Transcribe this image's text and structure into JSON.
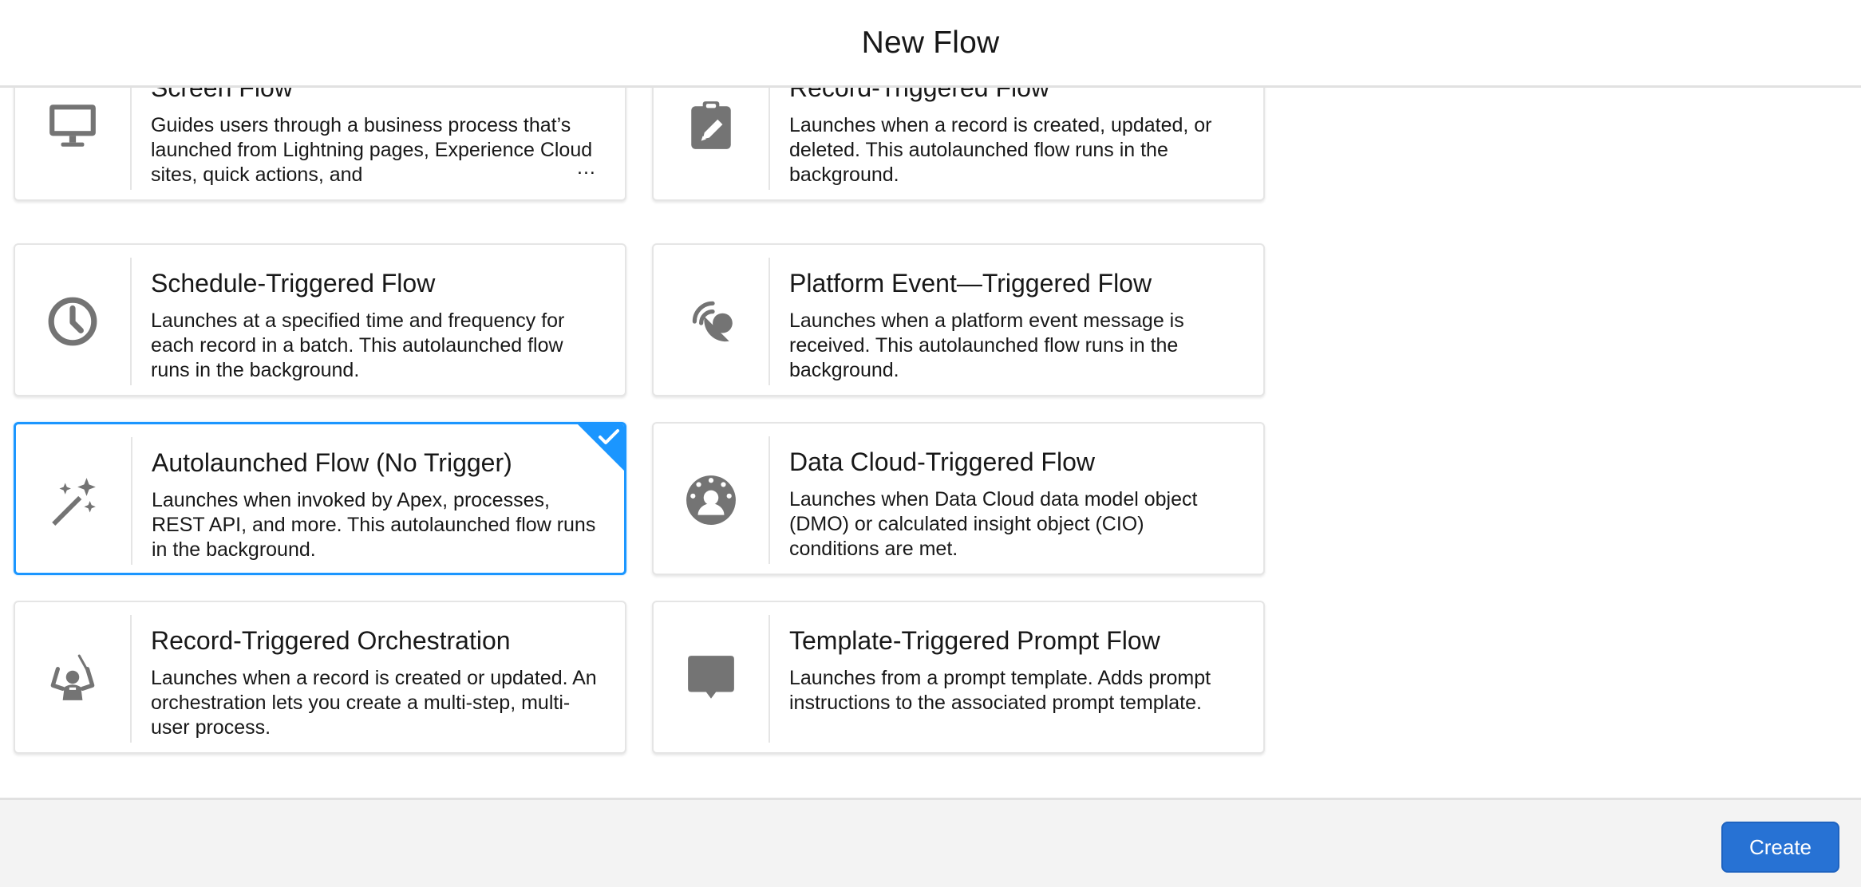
{
  "header": {
    "title": "New Flow"
  },
  "flow_types": [
    {
      "title": "Screen Flow",
      "description": "Guides users through a business process that’s launched from Lightning pages, Experience Cloud sites, quick actions, and",
      "more": "...",
      "icon": "monitor-icon",
      "selected": false
    },
    {
      "title": "Record-Triggered Flow",
      "description": "Launches when a record is created, updated, or deleted. This autolaunched flow runs in the background.",
      "icon": "clipboard-edit-icon",
      "selected": false
    },
    {
      "title": "Schedule-Triggered Flow",
      "description": "Launches at a specified time and frequency for each record in a batch. This autolaunched flow runs in the background.",
      "icon": "clock-icon",
      "selected": false
    },
    {
      "title": "Platform Event—Triggered Flow",
      "description": "Launches when a platform event message is received. This autolaunched flow runs in the background.",
      "icon": "satellite-dish-icon",
      "selected": false
    },
    {
      "title": "Autolaunched Flow (No Trigger)",
      "description": "Launches when invoked by Apex, processes, REST API, and more. This autolaunched flow runs in the background.",
      "icon": "magic-wand-icon",
      "selected": true
    },
    {
      "title": "Data Cloud-Triggered Flow",
      "description": "Launches when Data Cloud data model object (DMO) or calculated insight object (CIO) conditions are met.",
      "icon": "data-cloud-icon",
      "selected": false
    },
    {
      "title": "Record-Triggered Orchestration",
      "description": "Launches when a record is created or updated. An orchestration lets you create a multi-step, multi-user process.",
      "icon": "orchestrator-icon",
      "selected": false
    },
    {
      "title": "Template-Triggered Prompt Flow",
      "description": "Launches from a prompt template. Adds prompt instructions to the associated prompt template.",
      "icon": "chat-bubble-icon",
      "selected": false
    }
  ],
  "footer": {
    "create_label": "Create"
  },
  "colors": {
    "accent": "#1b96ff",
    "button": "#2772d4",
    "icon": "#747474"
  }
}
